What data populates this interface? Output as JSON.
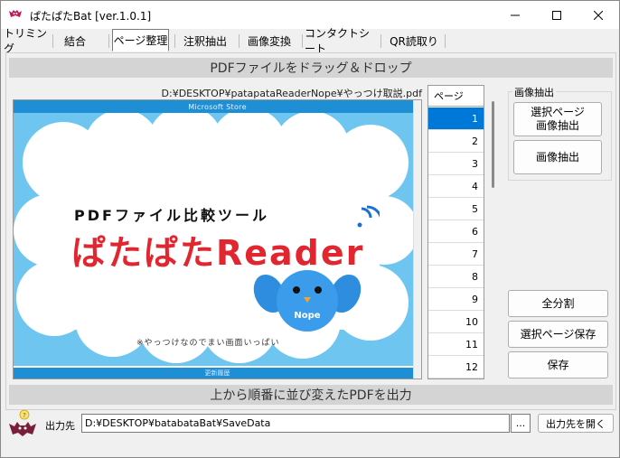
{
  "window": {
    "title": "ぱたぱたBat [ver.1.0.1]"
  },
  "tabs": [
    {
      "label": "トリミング"
    },
    {
      "label": "結合"
    },
    {
      "label": "ページ整理"
    },
    {
      "label": "注釈抽出"
    },
    {
      "label": "画像変換"
    },
    {
      "label": "コンタクトシート"
    },
    {
      "label": "QR読取り"
    }
  ],
  "main": {
    "drop_banner": "PDFファイルをドラッグ＆ドロップ",
    "file_path": "D:¥DESKTOP¥patapataReaderNope¥やっつけ取説.pdf",
    "preview": {
      "top_bar": "Microsoft Store",
      "subtitle": "PDFファイル比較ツール",
      "logo": "ぱたぱたReader",
      "mascot_label": "Nope",
      "note": "※やっつけなのでまい画面いっぱい",
      "bottom_bar": "更新履歴"
    },
    "page_list": {
      "header": "ページ",
      "pages": [
        "1",
        "2",
        "3",
        "4",
        "5",
        "6",
        "7",
        "8",
        "9",
        "10",
        "11",
        "12"
      ],
      "selected": "1"
    },
    "image_extract": {
      "title": "画像抽出",
      "selected_pages_btn_line1": "選択ページ",
      "selected_pages_btn_line2": "画像抽出",
      "extract_btn": "画像抽出"
    },
    "actions": {
      "split_all": "全分割",
      "save_selected": "選択ページ保存",
      "save": "保存"
    },
    "bottom_banner": "上から順番に並び変えたPDFを出力"
  },
  "output": {
    "label": "出力先",
    "path": "D:¥DESKTOP¥batabataBat¥SaveData",
    "browse": "...",
    "open_folder": "出力先を開く"
  },
  "colors": {
    "selection": "#0078d7",
    "preview_sky": "#6ec6f0",
    "preview_bar": "#1e8fd5",
    "logo_red": "#e2262f"
  }
}
